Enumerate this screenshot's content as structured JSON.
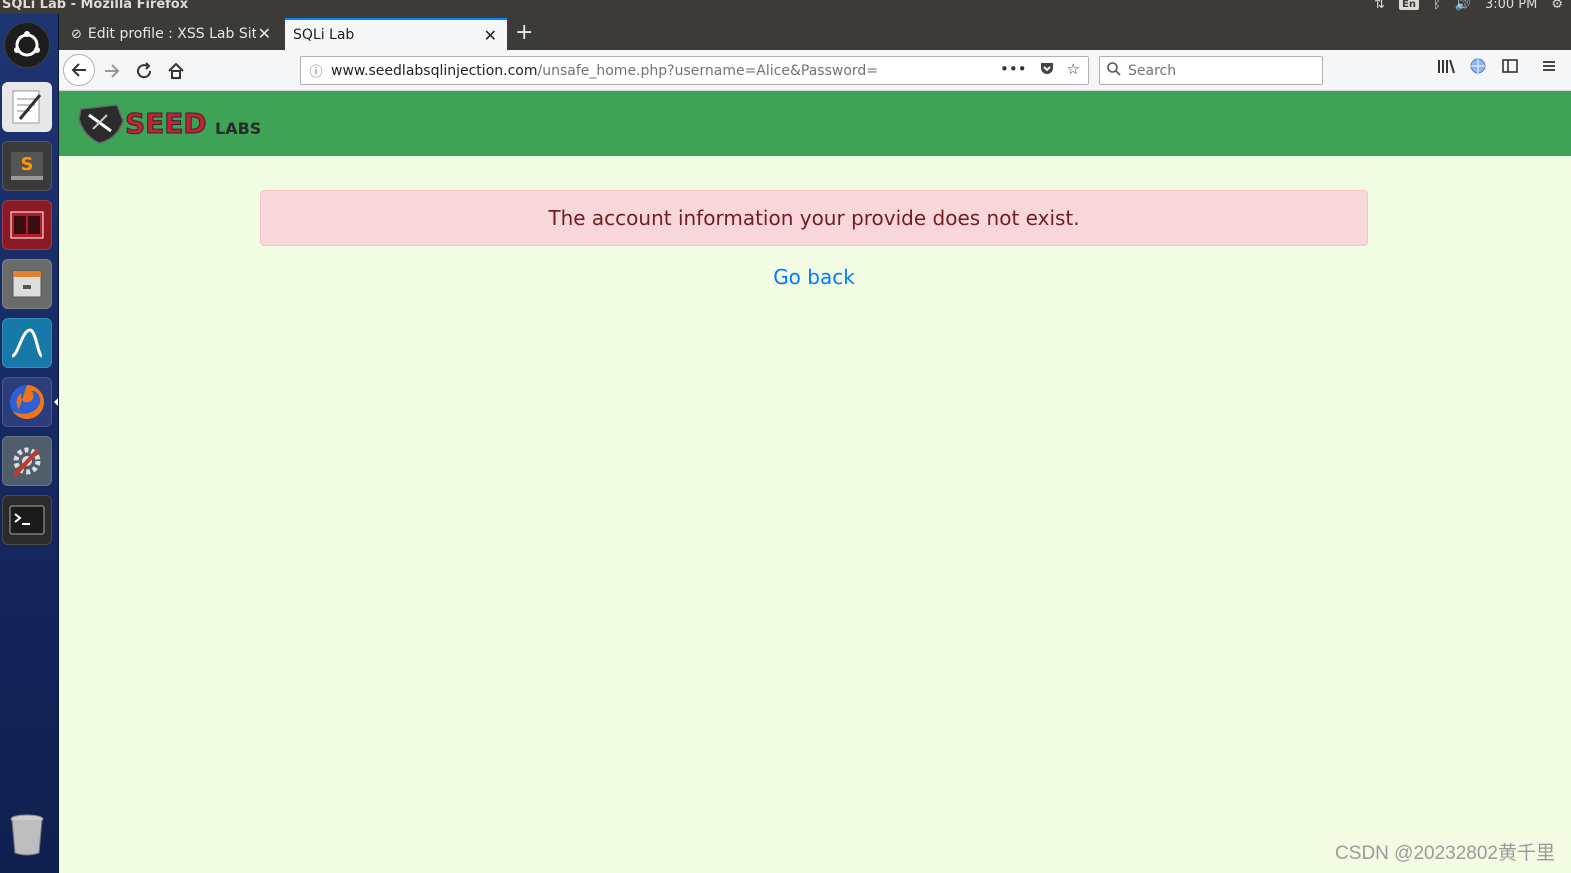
{
  "system": {
    "window_title": "SQLi Lab - Mozilla Firefox",
    "keyboard_layout": "En",
    "clock": "3:00 PM"
  },
  "launcher": {
    "items": [
      {
        "name": "ubuntu-dash-icon",
        "color": "#2a2a2a"
      },
      {
        "name": "text-editor-icon",
        "color": "#e8e8e8"
      },
      {
        "name": "sublime-text-icon",
        "color": "#444444"
      },
      {
        "name": "terminal-split-icon",
        "color": "#b51c2a"
      },
      {
        "name": "file-manager-icon",
        "color": "#6b6b6b"
      },
      {
        "name": "wireshark-icon",
        "color": "#1679a7"
      },
      {
        "name": "firefox-icon",
        "color": "#e66000"
      },
      {
        "name": "system-settings-icon",
        "color": "#5a6a7a"
      },
      {
        "name": "terminal-icon",
        "color": "#2b2b2b"
      },
      {
        "name": "trash-icon",
        "color": "#555555"
      }
    ]
  },
  "tabs": [
    {
      "label": "Edit profile : XSS Lab Site",
      "active": false
    },
    {
      "label": "SQLi Lab",
      "active": true
    }
  ],
  "nav": {
    "url_host": "www.seedlabsqlinjection.com",
    "url_path": "/unsafe_home.php?username=Alice&Password=",
    "search_placeholder": "Search"
  },
  "page": {
    "brand": "SEEDLABS",
    "alert_message": "The account information your provide does not exist.",
    "go_back": "Go back",
    "header_color": "#3fa357",
    "alert_bg": "#f8d7da",
    "link_color": "#007bff"
  },
  "watermark": "CSDN @20232802黄千里"
}
